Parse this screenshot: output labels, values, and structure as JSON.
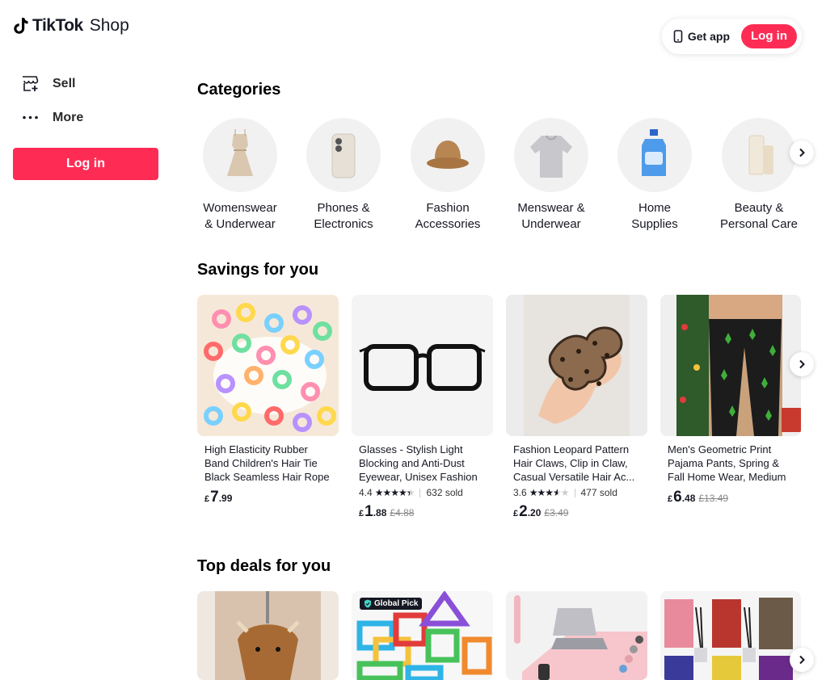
{
  "brand": {
    "name_bold": "TikTok",
    "name_light": "Shop"
  },
  "header": {
    "get_app": "Get app",
    "login": "Log in"
  },
  "sidebar": {
    "items": [
      {
        "label": "Sell",
        "icon": "store-add-icon"
      },
      {
        "label": "More",
        "icon": "more-dots-icon"
      }
    ],
    "login": "Log in"
  },
  "categories": {
    "title": "Categories",
    "items": [
      {
        "line1": "Womenswear",
        "line2": "& Underwear"
      },
      {
        "line1": "Phones &",
        "line2": "Electronics"
      },
      {
        "line1": "Fashion",
        "line2": "Accessories"
      },
      {
        "line1": "Menswear &",
        "line2": "Underwear"
      },
      {
        "line1": "Home",
        "line2": "Supplies"
      },
      {
        "line1": "Beauty &",
        "line2": "Personal Care"
      }
    ]
  },
  "savings": {
    "title": "Savings for you",
    "products": [
      {
        "title": "High Elasticity Rubber Band Children's Hair Tie Black Seamless Hair Rope H...",
        "rating": "",
        "sold": "",
        "currency": "£",
        "price_main": "7",
        "price_dec": ".99",
        "original": ""
      },
      {
        "title": "Glasses - Stylish Light Blocking and Anti-Dust Eyewear, Unisex Fashion Acc...",
        "rating": "4.4",
        "stars": 4.4,
        "sold": "632 sold",
        "currency": "£",
        "price_main": "1",
        "price_dec": ".88",
        "original": "£4.88"
      },
      {
        "title": "Fashion Leopard Pattern Hair Claws, Clip in Claw, Casual Versatile Hair Ac...",
        "rating": "3.6",
        "stars": 3.6,
        "sold": "477 sold",
        "currency": "£",
        "price_main": "2",
        "price_dec": ".20",
        "original": "£3.49"
      },
      {
        "title": "Men's Geometric Print Pajama Pants, Spring & Fall Home Wear, Medium Str...",
        "rating": "",
        "sold": "",
        "currency": "£",
        "price_main": "6",
        "price_dec": ".48",
        "original": "£13.49"
      }
    ]
  },
  "deals": {
    "title": "Top deals for you",
    "badge": "Global Pick"
  },
  "colors": {
    "accent": "#fe2c55",
    "text": "#161823"
  }
}
